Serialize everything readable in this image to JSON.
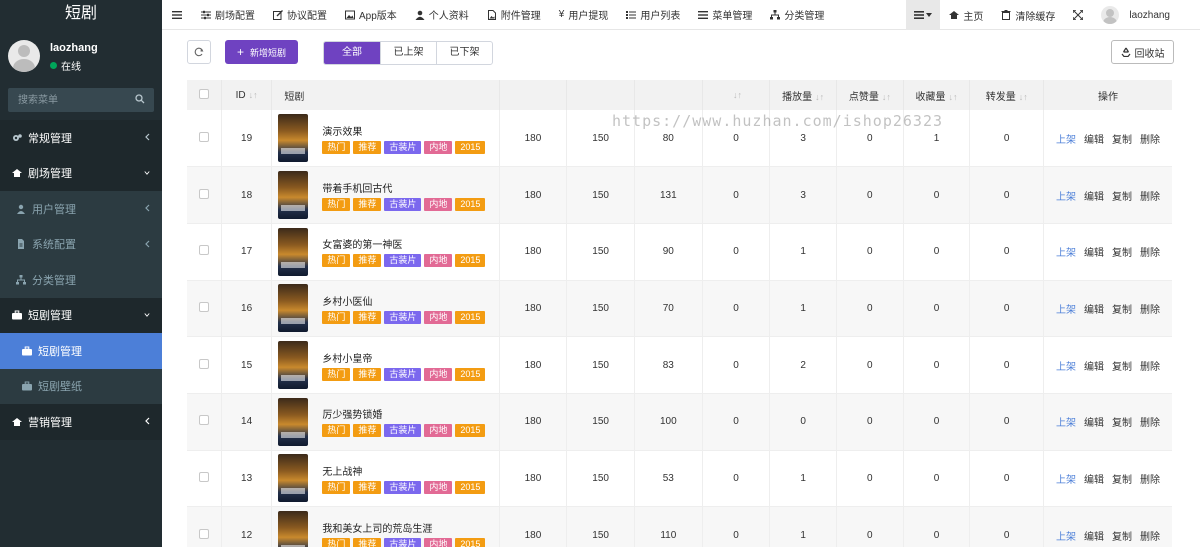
{
  "sidebar": {
    "logo": "短剧",
    "user": {
      "name": "laozhang",
      "status": "在线"
    },
    "search_placeholder": "搜索菜单",
    "menu": [
      {
        "label": "常规管理",
        "icon": "cogs-icon"
      },
      {
        "label": "剧场管理",
        "icon": "home-icon"
      },
      {
        "label": "用户管理",
        "icon": "user-icon"
      },
      {
        "label": "系统配置",
        "icon": "file-icon"
      },
      {
        "label": "分类管理",
        "icon": "sitemap-icon"
      },
      {
        "label": "短剧管理",
        "icon": "briefcase-icon"
      },
      {
        "label": "短剧管理",
        "icon": "briefcase-icon"
      },
      {
        "label": "短剧壁纸",
        "icon": "briefcase-icon"
      },
      {
        "label": "营销管理",
        "icon": "home-icon"
      }
    ]
  },
  "topnav": {
    "items": [
      "剧场配置",
      "协议配置",
      "App版本",
      "个人资料",
      "附件管理",
      "用户提现",
      "用户列表",
      "菜单管理",
      "分类管理"
    ],
    "home": "主页",
    "clear_cache": "清除缓存",
    "username": "laozhang"
  },
  "toolbar": {
    "add_label": "新增短剧",
    "filters": [
      "全部",
      "已上架",
      "已下架"
    ],
    "recycle_label": "回收站"
  },
  "watermark": "https://www.huzhan.com/ishop26323",
  "table": {
    "headers": [
      "ID",
      "短剧",
      "",
      "",
      "",
      "",
      "播放量",
      "点赞量",
      "收藏量",
      "转发量",
      "操作"
    ],
    "rows": [
      {
        "id": "19",
        "title": "演示效果",
        "c1": "180",
        "c2": "150",
        "c3": "80",
        "c4": "0",
        "play": "3",
        "like": "0",
        "fav": "1",
        "share": "0"
      },
      {
        "id": "18",
        "title": "带着手机回古代",
        "c1": "180",
        "c2": "150",
        "c3": "131",
        "c4": "0",
        "play": "3",
        "like": "0",
        "fav": "0",
        "share": "0"
      },
      {
        "id": "17",
        "title": "女富婆的第一神医",
        "c1": "180",
        "c2": "150",
        "c3": "90",
        "c4": "0",
        "play": "1",
        "like": "0",
        "fav": "0",
        "share": "0"
      },
      {
        "id": "16",
        "title": "乡村小医仙",
        "c1": "180",
        "c2": "150",
        "c3": "70",
        "c4": "0",
        "play": "1",
        "like": "0",
        "fav": "0",
        "share": "0"
      },
      {
        "id": "15",
        "title": "乡村小皇帝",
        "c1": "180",
        "c2": "150",
        "c3": "83",
        "c4": "0",
        "play": "2",
        "like": "0",
        "fav": "0",
        "share": "0"
      },
      {
        "id": "14",
        "title": "厉少强势锁婚",
        "c1": "180",
        "c2": "150",
        "c3": "100",
        "c4": "0",
        "play": "0",
        "like": "0",
        "fav": "0",
        "share": "0"
      },
      {
        "id": "13",
        "title": "无上战神",
        "c1": "180",
        "c2": "150",
        "c3": "53",
        "c4": "0",
        "play": "1",
        "like": "0",
        "fav": "0",
        "share": "0"
      },
      {
        "id": "12",
        "title": "我和美女上司的荒岛生涯",
        "c1": "180",
        "c2": "150",
        "c3": "110",
        "c4": "0",
        "play": "1",
        "like": "0",
        "fav": "0",
        "share": "0"
      }
    ],
    "tags": [
      {
        "label": "热门",
        "color": "#f39c12"
      },
      {
        "label": "推荐",
        "color": "#f39c12"
      },
      {
        "label": "古装片",
        "color": "#7b68ee"
      },
      {
        "label": "内地",
        "color": "#e26a95"
      },
      {
        "label": "2015",
        "color": "#f39c12"
      }
    ],
    "ops": [
      "上架",
      "编辑",
      "复制",
      "删除"
    ]
  }
}
